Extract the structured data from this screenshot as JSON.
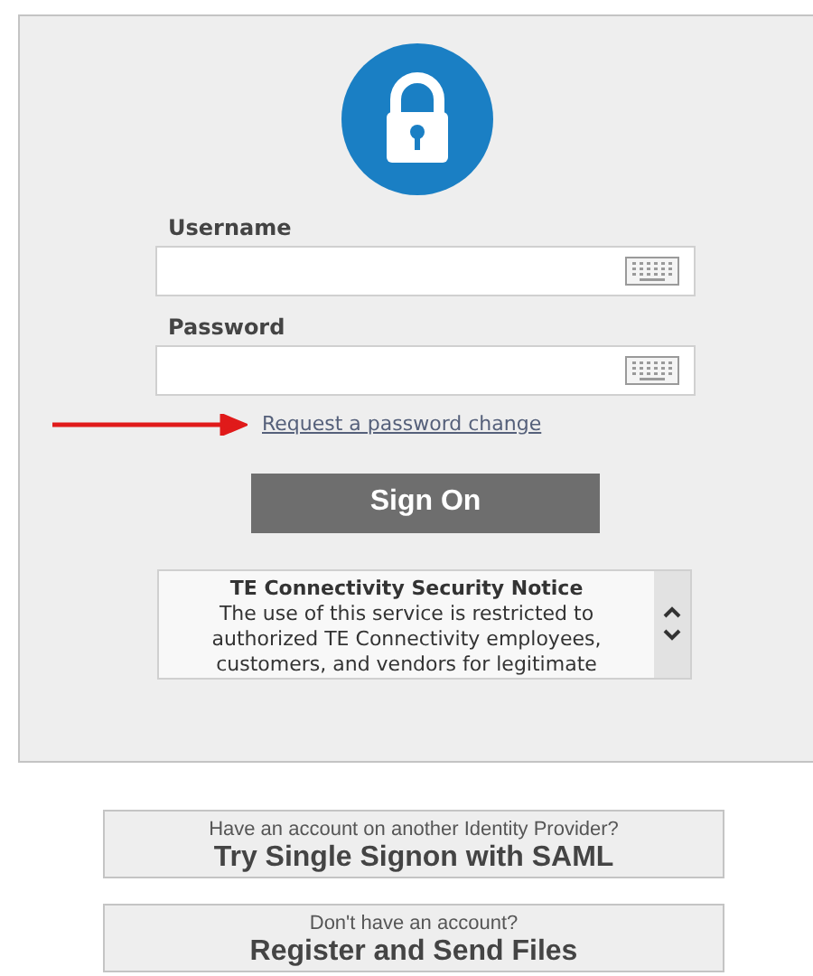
{
  "fields": [
    {
      "label": "Username"
    },
    {
      "label": "Password"
    }
  ],
  "password_link": "Request a password change",
  "sign_on_button": "Sign On",
  "notice": {
    "title": "TE Connectivity Security Notice",
    "body": "The use of this service is restricted to authorized TE Connectivity employees, customers, and vendors for legitimate"
  },
  "alt_buttons": [
    {
      "hint": "Have an account on another Identity Provider?",
      "label": "Try Single Signon with SAML"
    },
    {
      "hint": "Don't have an account?",
      "label": "Register and Send Files"
    }
  ]
}
